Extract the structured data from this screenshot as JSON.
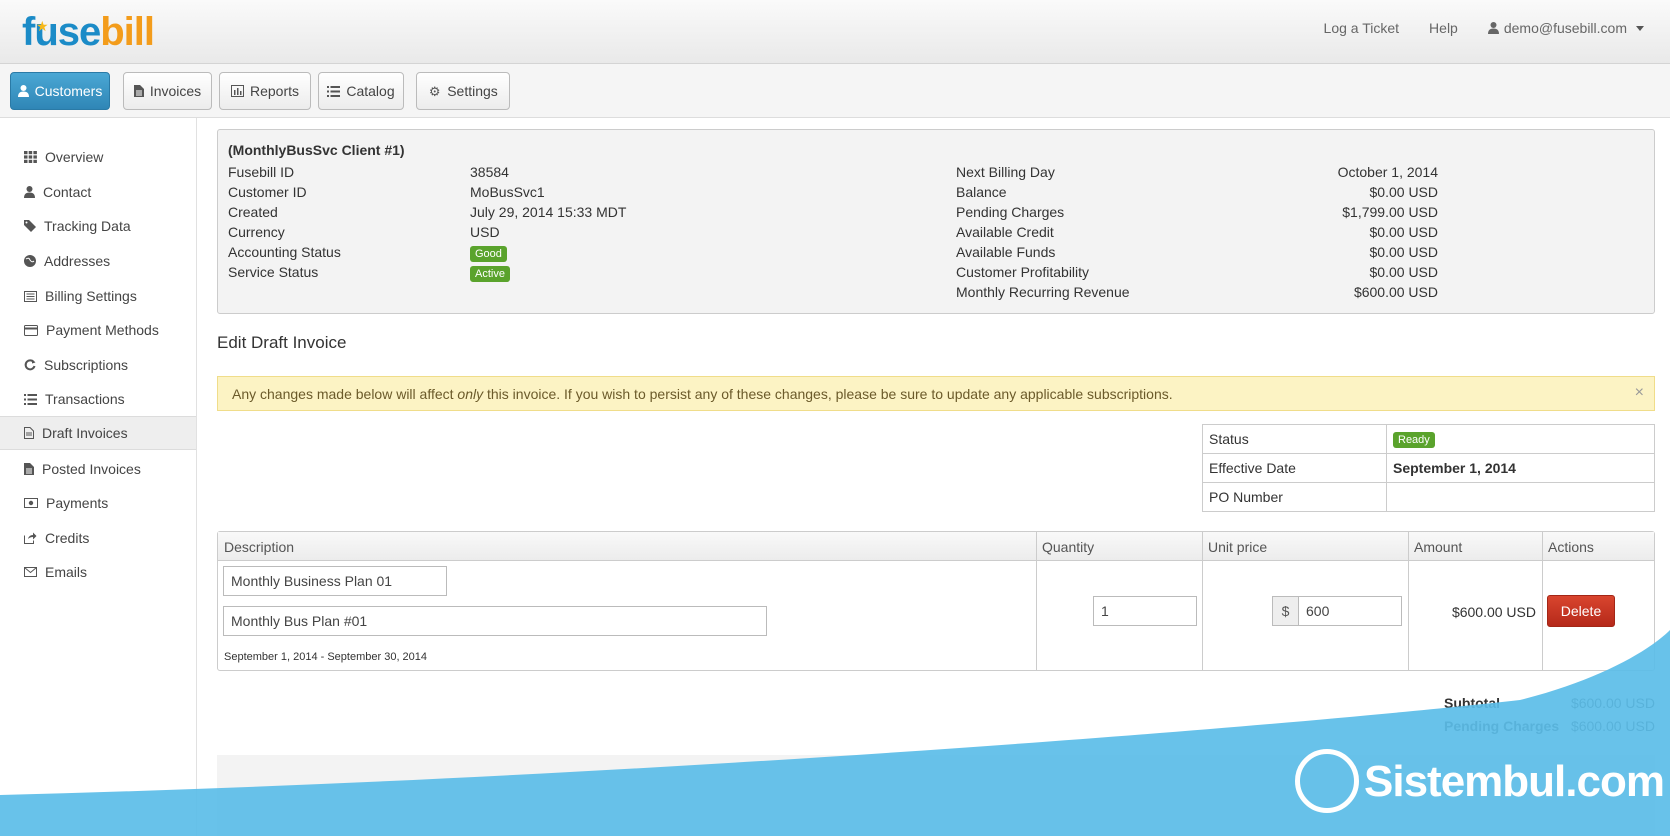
{
  "header": {
    "logo_fuse": "fuse",
    "logo_bill": "bill",
    "links": {
      "ticket": "Log a Ticket",
      "help": "Help",
      "user": "demo@fusebill.com"
    }
  },
  "nav": {
    "customers": "Customers",
    "invoices": "Invoices",
    "reports": "Reports",
    "catalog": "Catalog",
    "settings": "Settings"
  },
  "sidebar": {
    "items": [
      {
        "label": "Overview",
        "icon": "grid-icon"
      },
      {
        "label": "Contact",
        "icon": "user-icon"
      },
      {
        "label": "Tracking Data",
        "icon": "tag-icon"
      },
      {
        "label": "Addresses",
        "icon": "globe-icon"
      },
      {
        "label": "Billing Settings",
        "icon": "list-alt-icon"
      },
      {
        "label": "Payment Methods",
        "icon": "credit-card-icon"
      },
      {
        "label": "Subscriptions",
        "icon": "refresh-icon"
      },
      {
        "label": "Transactions",
        "icon": "list-icon"
      },
      {
        "label": "Draft Invoices",
        "icon": "file-icon"
      },
      {
        "label": "Posted Invoices",
        "icon": "file-text-icon"
      },
      {
        "label": "Payments",
        "icon": "money-icon"
      },
      {
        "label": "Credits",
        "icon": "share-icon"
      },
      {
        "label": "Emails",
        "icon": "envelope-icon"
      }
    ]
  },
  "customer": {
    "title": "(MonthlyBusSvc Client #1)",
    "left": [
      {
        "label": "Fusebill ID",
        "value": "38584"
      },
      {
        "label": "Customer ID",
        "value": "MoBusSvc1"
      },
      {
        "label": "Created",
        "value": "July 29, 2014 15:33 MDT"
      },
      {
        "label": "Currency",
        "value": "USD"
      },
      {
        "label": "Accounting Status",
        "value": "Good"
      },
      {
        "label": "Service Status",
        "value": "Active"
      }
    ],
    "right": [
      {
        "label": "Next Billing Day",
        "value": "October 1, 2014"
      },
      {
        "label": "Balance",
        "value": "$0.00 USD"
      },
      {
        "label": "Pending Charges",
        "value": "$1,799.00 USD"
      },
      {
        "label": "Available Credit",
        "value": "$0.00 USD"
      },
      {
        "label": "Available Funds",
        "value": "$0.00 USD"
      },
      {
        "label": "Customer Profitability",
        "value": "$0.00 USD"
      },
      {
        "label": "Monthly Recurring Revenue",
        "value": "$600.00 USD"
      }
    ]
  },
  "edit_title": "Edit Draft Invoice",
  "alert": {
    "pre": "Any changes made below will affect ",
    "em": "only",
    "post": " this invoice. If you wish to persist any of these changes, please be sure to update any applicable subscriptions.",
    "close": "×"
  },
  "invoice_status": {
    "status_label": "Status",
    "status_value": "Ready",
    "date_label": "Effective Date",
    "date_value": "September 1, 2014",
    "po_label": "PO Number",
    "po_value": ""
  },
  "items_table": {
    "headers": {
      "description": "Description",
      "quantity": "Quantity",
      "unit_price": "Unit price",
      "amount": "Amount",
      "actions": "Actions"
    },
    "row": {
      "name": "Monthly Business Plan 01",
      "description": "Monthly Bus Plan #01",
      "period": "September 1, 2014 - September 30, 2014",
      "quantity": "1",
      "currency_symbol": "$",
      "unit_price": "600",
      "amount": "$600.00 USD",
      "delete": "Delete"
    }
  },
  "totals": {
    "subtotal_label": "Subtotal",
    "subtotal_value": "$600.00 USD",
    "pending_label": "Pending Charges",
    "pending_value": "$600.00 USD"
  },
  "watermark": {
    "text": "Sistembul.com"
  },
  "colors": {
    "brand_blue": "#1b8bc7",
    "brand_orange": "#f39c1b",
    "active_nav": "#3a93c2",
    "badge_green": "#5aa32c",
    "delete_red": "#c23321",
    "watermark_blue": "#5bbde8"
  }
}
